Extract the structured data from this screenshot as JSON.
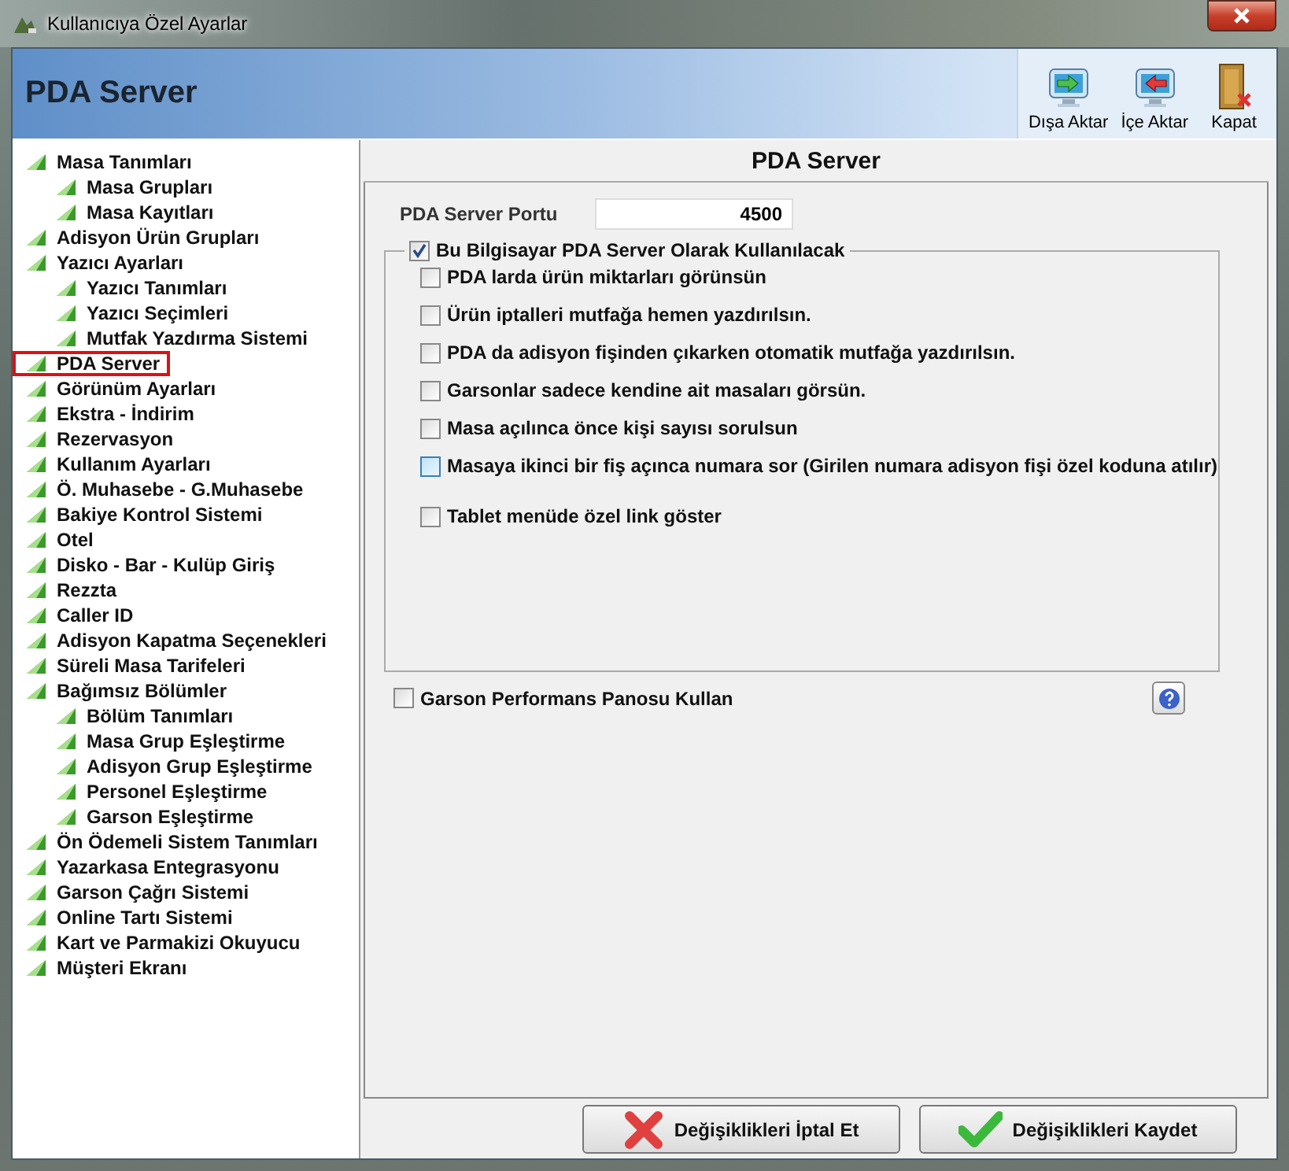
{
  "window": {
    "title": "Kullanıcıya Özel Ayarlar"
  },
  "header": {
    "title": "PDA Server",
    "tools": [
      {
        "kind": "export",
        "label": "Dışa Aktar"
      },
      {
        "kind": "import",
        "label": "İçe Aktar"
      },
      {
        "kind": "close",
        "label": "Kapat"
      }
    ]
  },
  "tree": [
    {
      "label": "Masa Tanımları",
      "selected": false,
      "children": [
        {
          "label": "Masa Grupları",
          "selected": false
        },
        {
          "label": "Masa Kayıtları",
          "selected": false
        }
      ]
    },
    {
      "label": "Adisyon Ürün Grupları",
      "selected": false
    },
    {
      "label": "Yazıcı Ayarları",
      "selected": false,
      "children": [
        {
          "label": "Yazıcı Tanımları",
          "selected": false
        },
        {
          "label": "Yazıcı Seçimleri",
          "selected": false
        },
        {
          "label": "Mutfak Yazdırma Sistemi",
          "selected": false
        }
      ]
    },
    {
      "label": "PDA Server",
      "selected": true
    },
    {
      "label": "Görünüm Ayarları",
      "selected": false
    },
    {
      "label": "Ekstra - İndirim",
      "selected": false
    },
    {
      "label": "Rezervasyon",
      "selected": false
    },
    {
      "label": "Kullanım Ayarları",
      "selected": false
    },
    {
      "label": "Ö. Muhasebe - G.Muhasebe",
      "selected": false
    },
    {
      "label": "Bakiye Kontrol Sistemi",
      "selected": false
    },
    {
      "label": "Otel",
      "selected": false
    },
    {
      "label": "Disko - Bar - Kulüp Giriş",
      "selected": false
    },
    {
      "label": "Rezzta",
      "selected": false
    },
    {
      "label": "Caller ID",
      "selected": false
    },
    {
      "label": "Adisyon Kapatma Seçenekleri",
      "selected": false
    },
    {
      "label": "Süreli Masa Tarifeleri",
      "selected": false
    },
    {
      "label": "Bağımsız Bölümler",
      "selected": false,
      "children": [
        {
          "label": "Bölüm Tanımları",
          "selected": false
        },
        {
          "label": "Masa Grup Eşleştirme",
          "selected": false
        },
        {
          "label": "Adisyon Grup Eşleştirme",
          "selected": false
        },
        {
          "label": "Personel Eşleştirme",
          "selected": false
        },
        {
          "label": "Garson Eşleştirme",
          "selected": false
        }
      ]
    },
    {
      "label": "Ön Ödemeli Sistem Tanımları",
      "selected": false
    },
    {
      "label": "Yazarkasa Entegrasyonu",
      "selected": false
    },
    {
      "label": "Garson Çağrı Sistemi",
      "selected": false
    },
    {
      "label": "Online Tartı Sistemi",
      "selected": false
    },
    {
      "label": "Kart ve Parmakizi Okuyucu",
      "selected": false
    },
    {
      "label": "Müşteri Ekranı",
      "selected": false
    }
  ],
  "panel": {
    "title": "PDA Server",
    "port_label": "PDA Server Portu",
    "port_value": "4500",
    "group": {
      "label": "Bu Bilgisayar PDA Server Olarak Kullanılacak",
      "checked": true,
      "options": [
        {
          "label": "PDA larda ürün miktarları görünsün",
          "checked": false,
          "hovered": false
        },
        {
          "label": "Ürün iptalleri mutfağa hemen yazdırılsın.",
          "checked": false,
          "hovered": false
        },
        {
          "label": "PDA da adisyon fişinden çıkarken otomatik mutfağa yazdırılsın.",
          "checked": false,
          "hovered": false
        },
        {
          "label": "Garsonlar sadece kendine ait masaları görsün.",
          "checked": false,
          "hovered": false
        },
        {
          "label": "Masa açılınca önce kişi sayısı sorulsun",
          "checked": false,
          "hovered": false
        },
        {
          "label": "Masaya ikinci bir fiş açınca numara sor (Girilen numara adisyon fişi özel koduna atılır)",
          "checked": false,
          "hovered": true
        },
        {
          "label": "Tablet menüde özel link göster",
          "checked": false,
          "hovered": false
        }
      ]
    },
    "performance": {
      "label": "Garson Performans Panosu Kullan",
      "checked": false
    }
  },
  "buttons": [
    {
      "kind": "cancel",
      "label": "Değişiklikleri İptal Et"
    },
    {
      "kind": "save",
      "label": "Değişiklikleri Kaydet"
    }
  ]
}
